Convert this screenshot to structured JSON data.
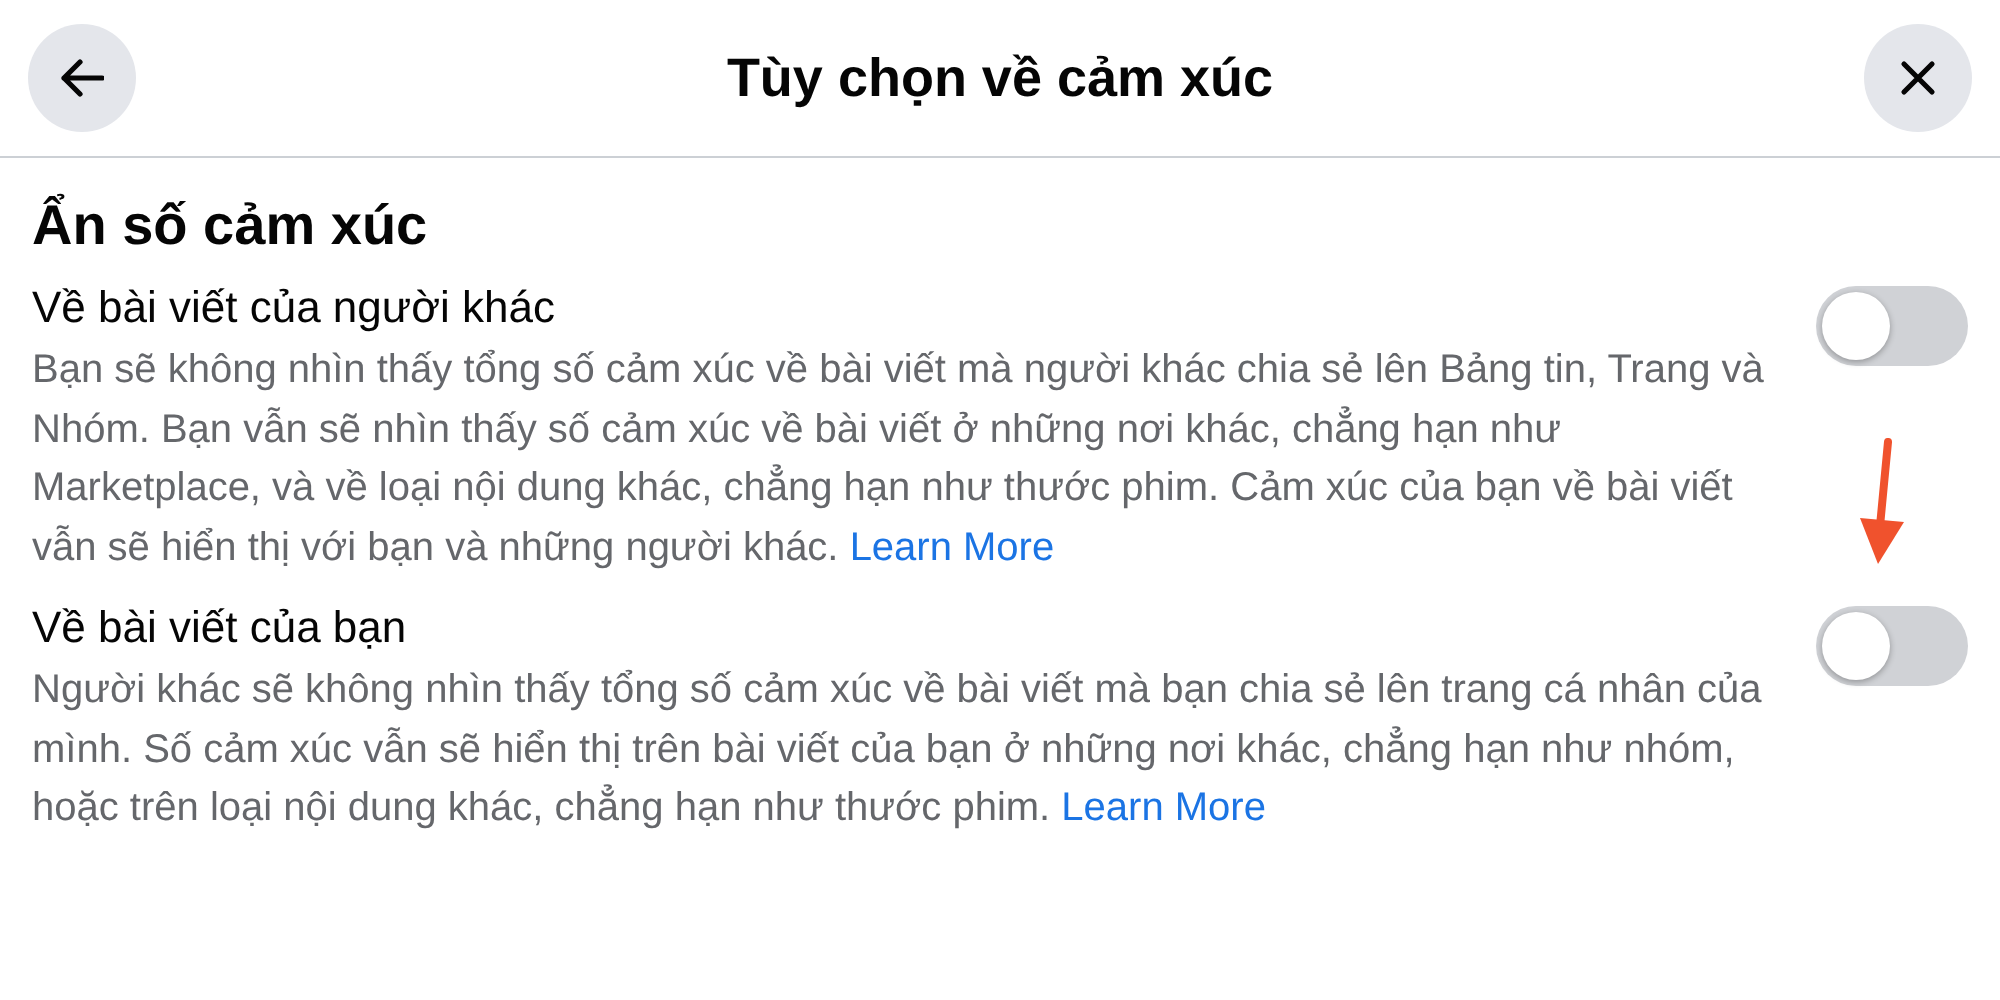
{
  "header": {
    "title": "Tùy chọn về cảm xúc"
  },
  "section_title": "Ẩn số cảm xúc",
  "settings": [
    {
      "title": "Về bài viết của người khác",
      "description": "Bạn sẽ không nhìn thấy tổng số cảm xúc về bài viết mà người khác chia sẻ lên Bảng tin, Trang và Nhóm. Bạn vẫn sẽ nhìn thấy số cảm xúc về bài viết ở những nơi khác, chẳng hạn như Marketplace, và về loại nội dung khác, chẳng hạn như thước phim. Cảm xúc của bạn về bài viết vẫn sẽ hiển thị với bạn và những người khác.",
      "link": "Learn More",
      "on": false
    },
    {
      "title": "Về bài viết của bạn",
      "description": "Người khác sẽ không nhìn thấy tổng số cảm xúc về bài viết mà bạn chia sẻ lên trang cá nhân của mình. Số cảm xúc vẫn sẽ hiển thị trên bài viết của bạn ở những nơi khác, chẳng hạn như nhóm, hoặc trên loại nội dung khác, chẳng hạn như thước phim.",
      "link": "Learn More",
      "on": false
    }
  ]
}
